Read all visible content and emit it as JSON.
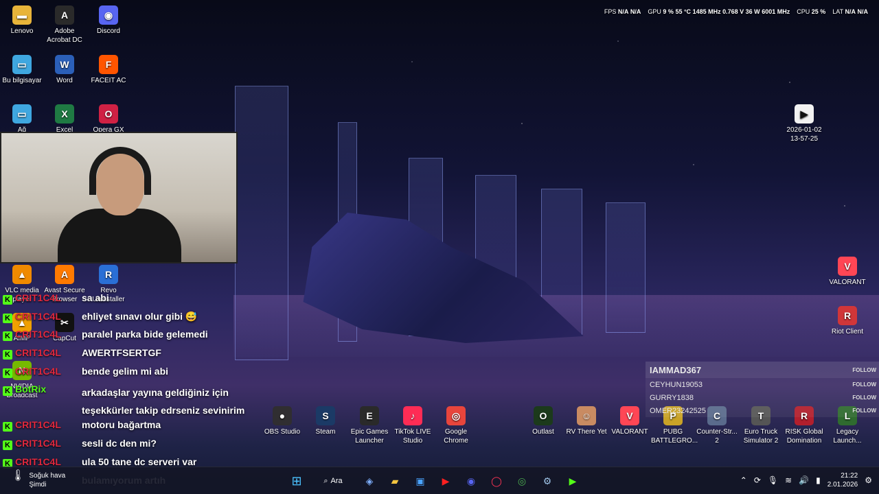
{
  "overlay": {
    "fps_label": "FPS",
    "fps1": "N/A",
    "fps2": "N/A",
    "gpu_label": "GPU",
    "gpu_load": "9 %",
    "gpu_temp": "55 °C",
    "gpu_clock": "1485 MHz",
    "gpu_volt": "0.768 V",
    "gpu_power": "36 W",
    "gpu_mem": "6001 MHz",
    "cpu_label": "CPU",
    "cpu_load": "25 %",
    "lat_label": "LAT",
    "lat1": "N/A",
    "lat2": "N/A"
  },
  "desktop_icons": [
    {
      "label": "Lenovo",
      "glyph": "▬",
      "color": "#e8b43a"
    },
    {
      "label": "Adobe Acrobat DC",
      "glyph": "A",
      "color": "#2a2a2a"
    },
    {
      "label": "Discord",
      "glyph": "◉",
      "color": "#5865f2"
    },
    {
      "label": "Bu bilgisayar",
      "glyph": "▭",
      "color": "#3fa7e0"
    },
    {
      "label": "Word",
      "glyph": "W",
      "color": "#2b5fb8"
    },
    {
      "label": "FACEIT AC",
      "glyph": "F",
      "color": "#ff5500"
    },
    {
      "label": "Ağ",
      "glyph": "▭",
      "color": "#3fa7e0"
    },
    {
      "label": "Excel",
      "glyph": "X",
      "color": "#1f7a43"
    },
    {
      "label": "Opera GX",
      "glyph": "O",
      "color": "#d02144"
    },
    {
      "label": "VLC media player",
      "glyph": "▲",
      "color": "#f08a00"
    },
    {
      "label": "Avast Secure Browser",
      "glyph": "A",
      "color": "#ff7a00"
    },
    {
      "label": "Revo Uninstaller",
      "glyph": "R",
      "color": "#2a6fd6"
    },
    {
      "label": "AIMP",
      "glyph": "▲",
      "color": "#f0a000"
    },
    {
      "label": "CapCut",
      "glyph": "✂",
      "color": "#111"
    },
    {
      "label": "NVIDIA Broadcast",
      "glyph": "N",
      "color": "#76b900"
    },
    {
      "label": "2026-01-02 13-57-25",
      "glyph": "▶",
      "color": "#f2f2f2"
    },
    {
      "label": "VALORANT",
      "glyph": "V",
      "color": "#ff4655"
    },
    {
      "label": "Riot Client",
      "glyph": "R",
      "color": "#d13639"
    },
    {
      "label": "OBS Studio",
      "glyph": "●",
      "color": "#302e31"
    },
    {
      "label": "Steam",
      "glyph": "S",
      "color": "#1b3a66"
    },
    {
      "label": "Epic Games Launcher",
      "glyph": "E",
      "color": "#2a2a2a"
    },
    {
      "label": "TikTok LIVE Studio",
      "glyph": "♪",
      "color": "#fe2c55"
    },
    {
      "label": "Google Chrome",
      "glyph": "◎",
      "color": "#e8453c"
    },
    {
      "label": "Outlast",
      "glyph": "O",
      "color": "#1c3a1c"
    },
    {
      "label": "RV There Yet",
      "glyph": "☺",
      "color": "#c98b62"
    },
    {
      "label": "VALORANT",
      "glyph": "V",
      "color": "#ff4655"
    },
    {
      "label": "PUBG BATTLEGRO...",
      "glyph": "P",
      "color": "#c9a227"
    },
    {
      "label": "Counter-Str... 2",
      "glyph": "C",
      "color": "#5a6b8c"
    },
    {
      "label": "Euro Truck Simulator 2",
      "glyph": "T",
      "color": "#555"
    },
    {
      "label": "RISK Global Domination",
      "glyph": "R",
      "color": "#b21f2d"
    },
    {
      "label": "Legacy Launch...",
      "glyph": "L",
      "color": "#2f6b2f"
    }
  ],
  "chat": [
    {
      "user": "CRIT1C4L",
      "msg": "sa abi",
      "bot": false
    },
    {
      "user": "CRIT1C4L",
      "msg": "ehliyet sınavı olur gibi 😅",
      "bot": false
    },
    {
      "user": "CRIT1C4L",
      "msg": "paralel parka bide gelemedi",
      "bot": false
    },
    {
      "user": "CRIT1C4L",
      "msg": "AWERTFSERTGF",
      "bot": false
    },
    {
      "user": "CRIT1C4L",
      "msg": "bende gelim mi abi",
      "bot": false
    },
    {
      "user": "BotRix",
      "msg": "arkadaşlar yayına geldiğiniz için teşekkürler takip edrseniz sevinirim",
      "bot": true
    },
    {
      "user": "CRIT1C4L",
      "msg": "motoru bağartma",
      "bot": false
    },
    {
      "user": "CRIT1C4L",
      "msg": "sesli dc den mi?",
      "bot": false
    },
    {
      "user": "CRIT1C4L",
      "msg": "ula 50 tane dc serveri var",
      "bot": false
    },
    {
      "user": "",
      "msg": "bulamıyorum artıh",
      "bot": false
    }
  ],
  "follows": [
    {
      "name": "IAMMAD367",
      "btn": "FOLLOW"
    },
    {
      "name": "CEYHUN19053",
      "btn": "FOLLOW"
    },
    {
      "name": "GURRY1838",
      "btn": "FOLLOW"
    },
    {
      "name": "OMER23242525",
      "btn": "FOLLOW"
    }
  ],
  "taskbar": {
    "weather_title": "Soğuk hava",
    "weather_sub": "Şimdi",
    "search_label": "Ara",
    "time": "21:22",
    "date": "2.01.2026"
  }
}
